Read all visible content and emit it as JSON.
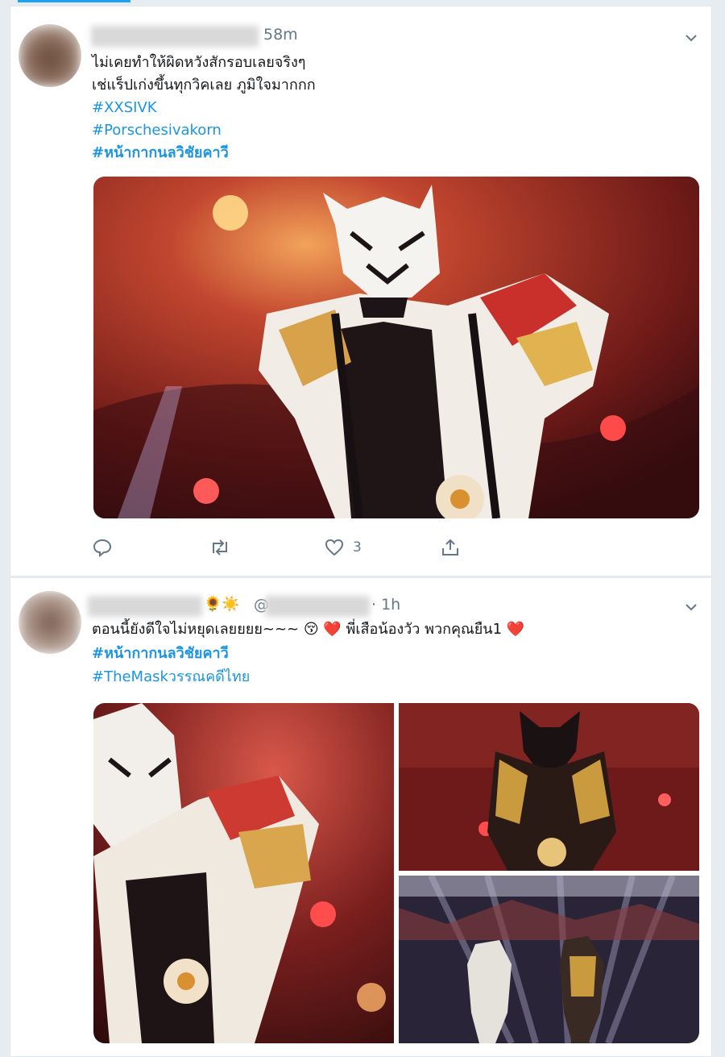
{
  "tweets": [
    {
      "time": "58m",
      "lines": [
        "ไม่เคยทำให้ผิดหวังสักรอบเลยจริงๆ",
        "เช่แร็ปเก่งขึ้นทุกวิคเลย ภูมิใจมากกก"
      ],
      "hashtags": [
        "#XXSIVK",
        "#Porschesivakorn",
        "#หน้ากากนลวิชัยคาวี"
      ],
      "actions": {
        "reply_count": "",
        "retweet_count": "",
        "like_count": "3"
      }
    },
    {
      "name_emoji": "🌻☀️",
      "handle_prefix": "@",
      "time": "· 1h",
      "line": "ตอนนี้ยังดีใจไม่หยุดเลยยยย~~~ 😚 ❤️ พี่เสือน้องวัว พวกคุณยืน1 ❤️",
      "hashtags": [
        "#หน้ากากนลวิชัยคาวี",
        "#TheMaskวรรณคดีไทย"
      ]
    }
  ],
  "colors": {
    "link": "#1b95e0",
    "muted": "#657786",
    "accent": "#1da1f2",
    "stage_red": "#b8342c"
  }
}
